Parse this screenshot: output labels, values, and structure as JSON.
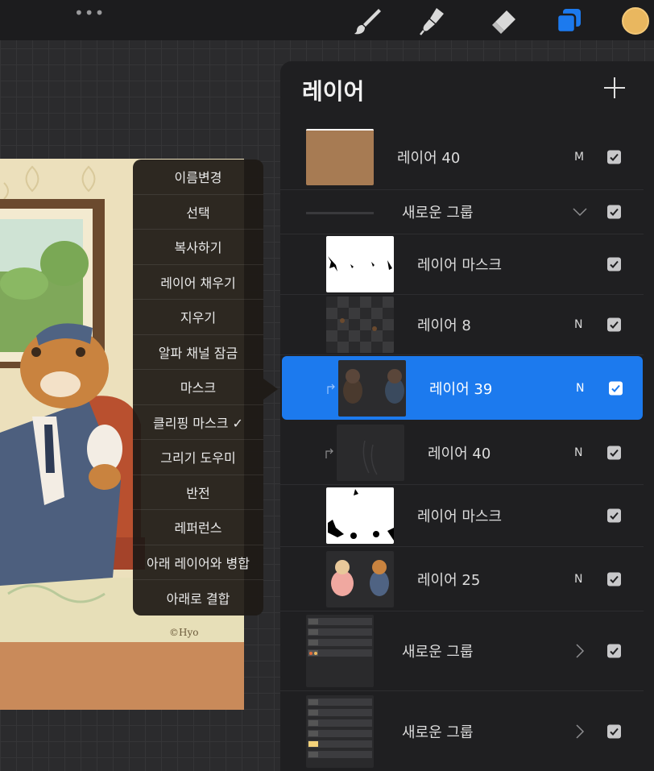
{
  "topbar": {
    "more_label": "•••",
    "tools": [
      {
        "name": "brush",
        "icon": "brush-icon"
      },
      {
        "name": "smudge",
        "icon": "smudge-icon"
      },
      {
        "name": "eraser",
        "icon": "eraser-icon"
      },
      {
        "name": "layers",
        "icon": "layers-icon",
        "active": true,
        "color": "#1c7aee"
      },
      {
        "name": "color",
        "icon": "color-swatch",
        "color": "#e9b75f"
      }
    ]
  },
  "artwork": {
    "signature": "©Hyo"
  },
  "context_menu": {
    "items": [
      "이름변경",
      "선택",
      "복사하기",
      "레이어 채우기",
      "지우기",
      "알파 채널 잠금",
      "마스크",
      "클리핑 마스크 ✓",
      "그리기 도우미",
      "반전",
      "레퍼런스",
      "아래 레이어와 병합",
      "아래로 결합"
    ]
  },
  "layers_panel": {
    "title": "레이어",
    "add_icon": "plus-icon",
    "selected_color": "#1c7aee",
    "layers": [
      {
        "name": "레이어 40",
        "blend": "M",
        "visible": true,
        "thumb": "brown"
      },
      {
        "name": "새로운 그룹",
        "blend": "",
        "visible": true,
        "thumb": "group-line",
        "group": true,
        "expanded": true
      },
      {
        "name": "레이어 마스크",
        "blend": "",
        "visible": true,
        "thumb": "mask1"
      },
      {
        "name": "레이어 8",
        "blend": "N",
        "visible": true,
        "thumb": "checker"
      },
      {
        "name": "레이어 39",
        "blend": "N",
        "visible": true,
        "thumb": "bears-dark",
        "selected": true,
        "clipped": true
      },
      {
        "name": "레이어 40",
        "blend": "N",
        "visible": true,
        "thumb": "dark-lines",
        "clipped": true
      },
      {
        "name": "레이어 마스크",
        "blend": "",
        "visible": true,
        "thumb": "mask2"
      },
      {
        "name": "레이어 25",
        "blend": "N",
        "visible": true,
        "thumb": "bears-color"
      },
      {
        "name": "새로운 그룹",
        "blend": "",
        "visible": true,
        "thumb": "group-list",
        "group": true,
        "expanded": false
      },
      {
        "name": "새로운 그룹",
        "blend": "",
        "visible": true,
        "thumb": "group-list2",
        "group": true,
        "expanded": false
      }
    ]
  }
}
